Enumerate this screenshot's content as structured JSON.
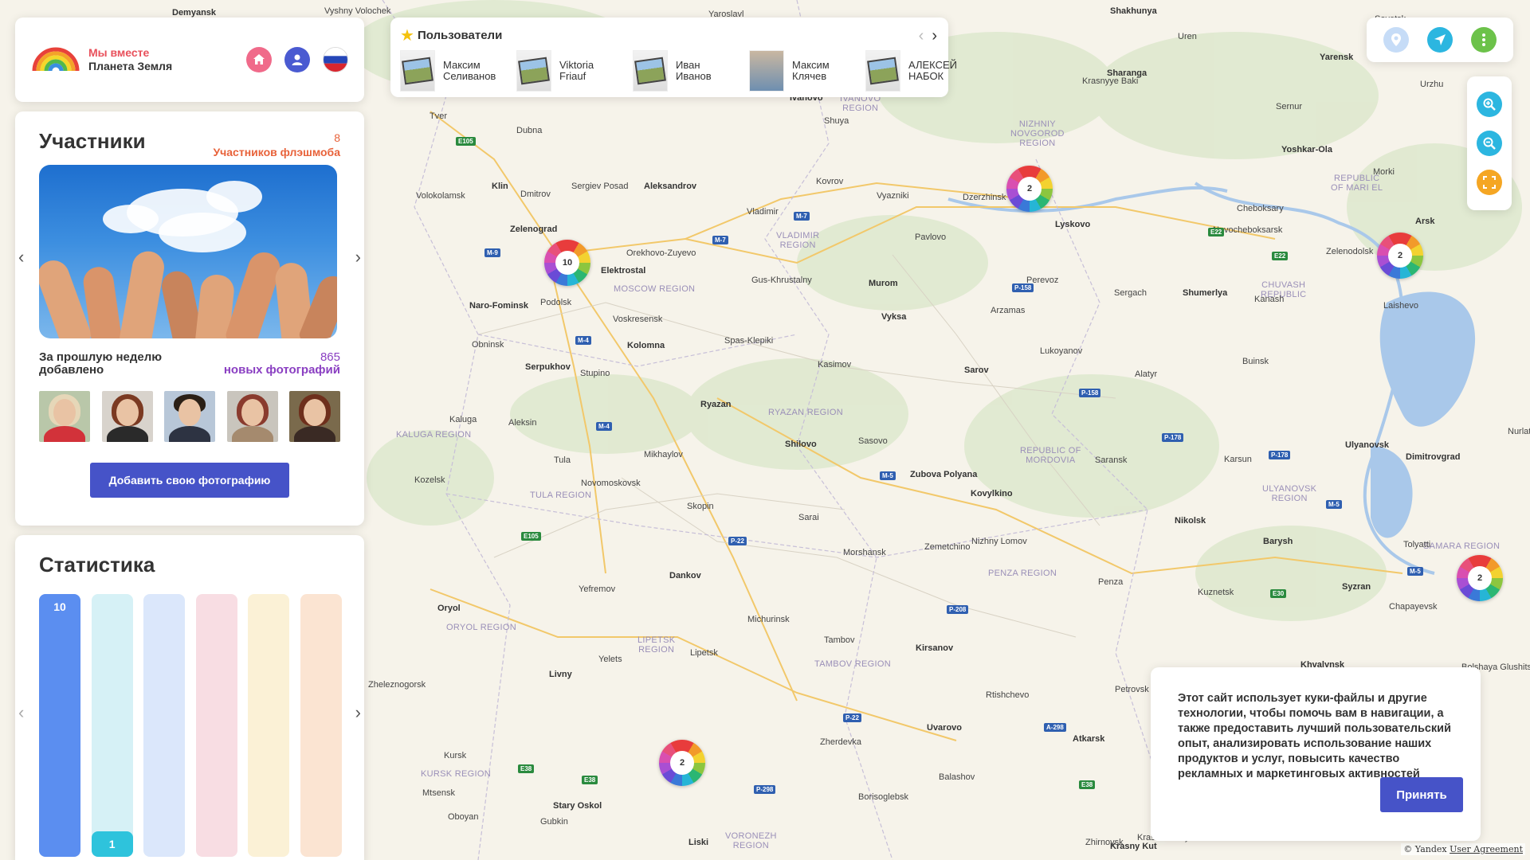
{
  "brand": {
    "line1": "Мы вместе",
    "line2": "Планета Земля"
  },
  "users": {
    "title": "Пользователи",
    "list": [
      {
        "name": "Максим\nСеливанов",
        "photo": "placeholder"
      },
      {
        "name": "Viktoria\nFriauf",
        "photo": "placeholder"
      },
      {
        "name": "Иван\nИванов",
        "photo": "placeholder"
      },
      {
        "name": "Максим\nКлячев",
        "photo": "face"
      },
      {
        "name": "АЛЕКСЕЙ\nНАБОК",
        "photo": "placeholder"
      }
    ]
  },
  "participants": {
    "title": "Участники",
    "flash_count": "8",
    "flash_label": "Участников флэшмоба",
    "week_label": "За прошлую неделю добавлено",
    "photos_count": "865",
    "photos_label": "новых фотографий",
    "add_button": "Добавить свою фотографию"
  },
  "stats": {
    "title": "Статистика",
    "bars": [
      {
        "value": "10",
        "color": "#5b8ef0",
        "fill": 1.0
      },
      {
        "value": "1",
        "color": "#d6f1f6",
        "fill": 0.1
      },
      {
        "value": "",
        "color": "#dbe7fb",
        "fill": 0
      },
      {
        "value": "",
        "color": "#f8dde3",
        "fill": 0
      },
      {
        "value": "",
        "color": "#fbf1d6",
        "fill": 0
      },
      {
        "value": "",
        "color": "#fbe4d2",
        "fill": 0
      }
    ]
  },
  "cookie": {
    "text": "Этот сайт использует куки-файлы и другие технологии, чтобы помочь вам в навигации, а также предоставить лучший пользовательский опыт, анализировать использование наших продуктов и услуг, повысить качество рекламных и маркетинговых активностей",
    "accept": "Принять"
  },
  "clusters": [
    {
      "count": "10"
    },
    {
      "count": "2"
    },
    {
      "count": "2"
    },
    {
      "count": "2"
    },
    {
      "count": "2"
    }
  ],
  "map": {
    "cities": [
      "Demyansk",
      "Vyshny Volochek",
      "Yaroslavl",
      "Shakhunya",
      "Sovetsk",
      "Uren",
      "Yarensk",
      "Tver",
      "Dubna",
      "Ivanovo",
      "Shuya",
      "Krasnyye Baki",
      "Sharanga",
      "Sernur",
      "Urzhu",
      "Klin",
      "Dmitrov",
      "Sergiev Posad",
      "Aleksandrov",
      "Kovrov",
      "Dzerzhinsk",
      "Yoshkar-Ola",
      "Morki",
      "Volokolamsk",
      "Zelenograd",
      "Vladimir",
      "Vyazniki",
      "Lyskovo",
      "Cheboksary",
      "Novocheboksarsk",
      "Arsk",
      "Orekhovo-Zuyevo",
      "Pavlovo",
      "Elektrostal",
      "Zelenodolsk",
      "Gus-Khrustalny",
      "Murom",
      "Perevoz",
      "Sergach",
      "Shumerlya",
      "Kanash",
      "Laishevo",
      "Naro-Fominsk",
      "Podolsk",
      "Voskresensk",
      "Vyksa",
      "Arzamas",
      "Obninsk",
      "Kolomna",
      "Spas-Klepiki",
      "Lukoyanov",
      "Serpukhov",
      "Stupino",
      "Kasimov",
      "Sarov",
      "Alatyr",
      "Buinsk",
      "Ryazan",
      "Kaluga",
      "Aleksin",
      "Shilovo",
      "Sasovo",
      "Saransk",
      "Ulyanovsk",
      "Nurlat",
      "Karsun",
      "Dimitrovgrad",
      "Tula",
      "Mikhaylov",
      "Zubova Polyana",
      "Kozelsk",
      "Novomoskovsk",
      "Kovylkino",
      "Skopin",
      "Sarai",
      "Nikolsk",
      "Zemetchino",
      "Nizhny Lomov",
      "Barysh",
      "Tolyatti",
      "Morshansk",
      "Dankov",
      "Penza",
      "Kuznetsk",
      "Syzran",
      "Chapayevsk",
      "Yefremov",
      "Oryol",
      "Michurinsk",
      "Tambov",
      "Kirsanov",
      "Lipetsk",
      "Yelets",
      "Livny",
      "Zheleznogorsk",
      "Bolshaya Glushitsa",
      "Khvalynsk",
      "Petrovsk",
      "Rtishchevo",
      "Uvarovo",
      "Zherdevka",
      "Kursk",
      "Stary Oskol",
      "Gubkin",
      "Oboyan",
      "Atkarsk",
      "Balashov",
      "Borisoglebsk",
      "Liski",
      "Zhirnovsk",
      "Krasnoarmeysk",
      "Krasny Kut",
      "Mtsensk"
    ],
    "yandex": "© Yandex",
    "agreement": "User Agreement"
  }
}
